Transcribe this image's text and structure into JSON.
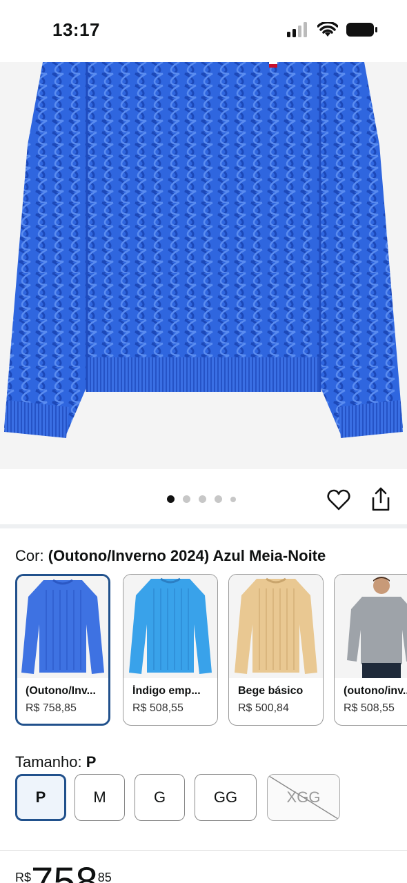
{
  "status_bar": {
    "time": "13:17"
  },
  "gallery": {
    "dots": 5,
    "active_index": 0
  },
  "color": {
    "label": "Cor:",
    "value": "(Outono/Inverno 2024) Azul Meia-Noite",
    "swatches": [
      {
        "name": "(Outono/Inverno 2024) Azul Meia-Noite",
        "display_name": "(Outono/Inv...",
        "price": "R$ 758,85",
        "selected": true,
        "color": "#3a6fe0"
      },
      {
        "name": "Índigo emp...",
        "display_name": "Índigo emp...",
        "price": "R$ 508,55",
        "selected": false,
        "color": "#3aa0e8"
      },
      {
        "name": "Bege básico",
        "display_name": "Bege básico",
        "price": "R$ 500,84",
        "selected": false,
        "color": "#e8c690"
      },
      {
        "name": "(outono/inv...",
        "display_name": "(outono/inv...",
        "price": "R$ 508,55",
        "selected": false,
        "color": "#9ea3aa"
      }
    ]
  },
  "size": {
    "label": "Tamanho:",
    "value": "P",
    "options": [
      {
        "label": "P",
        "selected": true,
        "available": true
      },
      {
        "label": "M",
        "selected": false,
        "available": true
      },
      {
        "label": "G",
        "selected": false,
        "available": true
      },
      {
        "label": "GG",
        "selected": false,
        "available": true
      },
      {
        "label": "XGG",
        "selected": false,
        "available": false
      }
    ]
  },
  "price": {
    "currency": "R$",
    "whole": "758",
    "cents": "85"
  },
  "colors": {
    "accent": "#21518c",
    "sweater": "#2e63dc"
  }
}
